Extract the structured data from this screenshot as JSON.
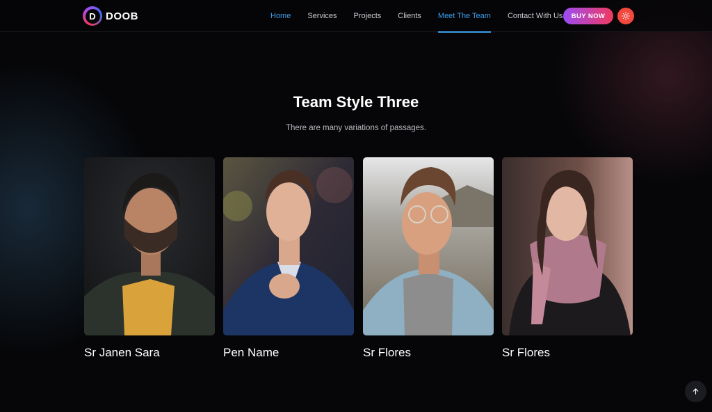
{
  "brand": {
    "name": "DOOB",
    "mark_letter": "D"
  },
  "nav": {
    "items": [
      {
        "label": "Home",
        "state": "active"
      },
      {
        "label": "Services",
        "state": "normal"
      },
      {
        "label": "Projects",
        "state": "normal"
      },
      {
        "label": "Clients",
        "state": "normal"
      },
      {
        "label": "Meet The Team",
        "state": "current"
      },
      {
        "label": "Contact With Us",
        "state": "normal"
      }
    ]
  },
  "header": {
    "buy_label": "BUY NOW",
    "theme_icon": "sun-icon"
  },
  "section": {
    "title": "Team Style Three",
    "subtitle": "There are many variations of passages."
  },
  "team": [
    {
      "name": "Sr Janen Sara"
    },
    {
      "name": "Pen Name"
    },
    {
      "name": "Sr Flores"
    },
    {
      "name": "Sr Flores"
    }
  ],
  "scroll_top_icon": "arrow-up-icon",
  "colors": {
    "accent": "#3c9ee8",
    "button_gradient_start": "#9b4cf5",
    "button_gradient_end": "#f0395f",
    "theme_button": "#f2483f",
    "background": "#060608"
  }
}
